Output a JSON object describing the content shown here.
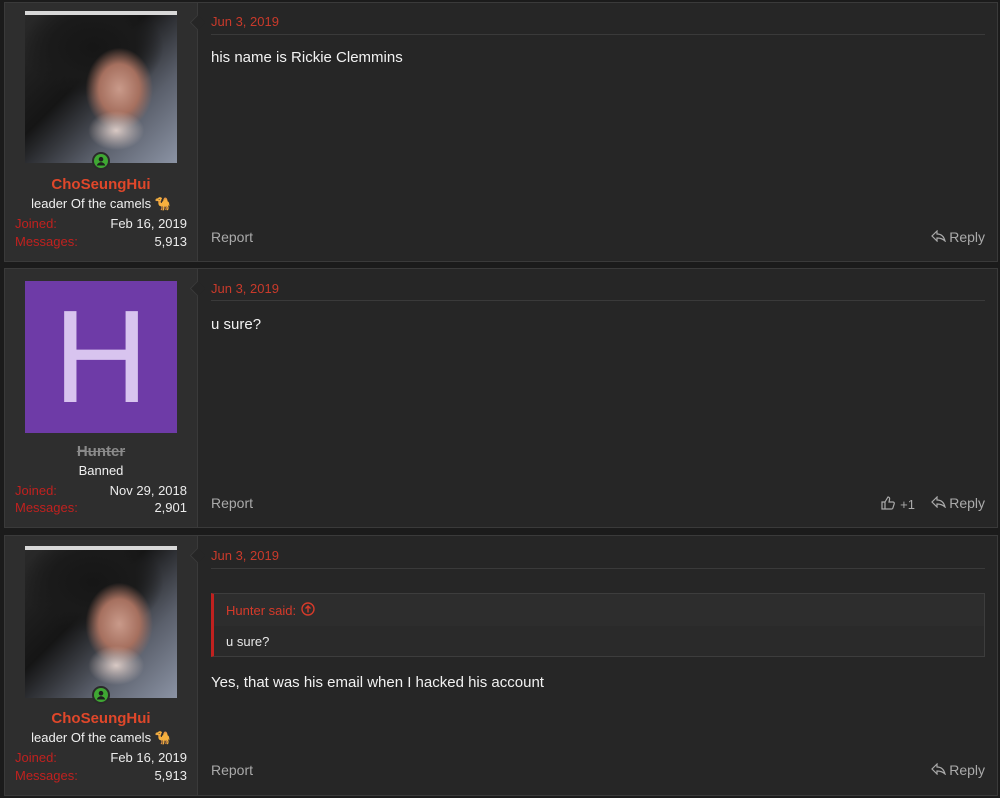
{
  "colors": {
    "accent": "#c93a2b",
    "username": "#e0472a",
    "background": "#262626",
    "user_panel": "#2e2e2e",
    "online": "#3fa733",
    "letter_avatar_bg": "#6e3ba7"
  },
  "posts": [
    {
      "date": "Jun 3, 2019",
      "username": "ChoSeungHui",
      "user_title": "leader Of the camels 🐪",
      "joined_label": "Joined:",
      "joined_value": "Feb 16, 2019",
      "messages_label": "Messages:",
      "messages_value": "5,913",
      "body": "his name is Rickie Clemmins",
      "report_label": "Report",
      "reply_label": "Reply"
    },
    {
      "date": "Jun 3, 2019",
      "username": "Hunter",
      "avatar_letter": "H",
      "user_title": "Banned",
      "joined_label": "Joined:",
      "joined_value": "Nov 29, 2018",
      "messages_label": "Messages:",
      "messages_value": "2,901",
      "body": "u sure?",
      "report_label": "Report",
      "like_count": "+1",
      "reply_label": "Reply"
    },
    {
      "date": "Jun 3, 2019",
      "username": "ChoSeungHui",
      "user_title": "leader Of the camels 🐪",
      "joined_label": "Joined:",
      "joined_value": "Feb 16, 2019",
      "messages_label": "Messages:",
      "messages_value": "5,913",
      "quote_author": "Hunter said:",
      "quote_text": "u sure?",
      "body": "Yes, that was his email when I hacked his account",
      "report_label": "Report",
      "reply_label": "Reply"
    }
  ]
}
